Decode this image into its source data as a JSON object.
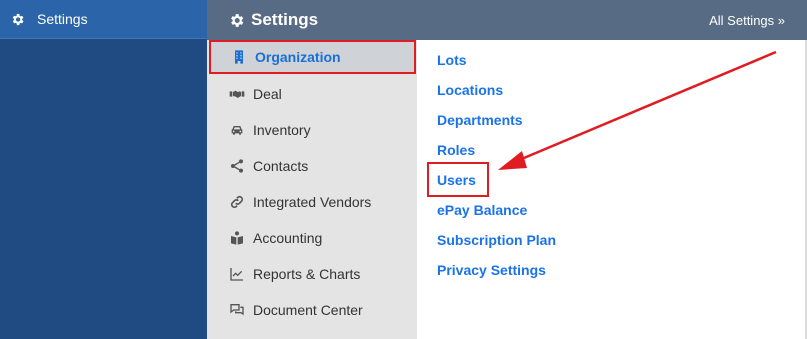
{
  "global_sidebar": {
    "settings_label": "Settings"
  },
  "header": {
    "title": "Settings",
    "all_settings": "All Settings »"
  },
  "categories": [
    {
      "label": "Organization",
      "icon": "building-icon",
      "active": true
    },
    {
      "label": "Deal",
      "icon": "handshake-icon",
      "active": false
    },
    {
      "label": "Inventory",
      "icon": "car-icon",
      "active": false
    },
    {
      "label": "Contacts",
      "icon": "share-icon",
      "active": false
    },
    {
      "label": "Integrated Vendors",
      "icon": "link-icon",
      "active": false
    },
    {
      "label": "Accounting",
      "icon": "book-reader-icon",
      "active": false
    },
    {
      "label": "Reports & Charts",
      "icon": "line-chart-icon",
      "active": false
    },
    {
      "label": "Document Center",
      "icon": "comments-icon",
      "active": false
    }
  ],
  "links": [
    {
      "label": "Lots"
    },
    {
      "label": "Locations"
    },
    {
      "label": "Departments"
    },
    {
      "label": "Roles"
    },
    {
      "label": "Users"
    },
    {
      "label": "ePay Balance"
    },
    {
      "label": "Subscription Plan"
    },
    {
      "label": "Privacy Settings"
    }
  ],
  "colors": {
    "accent": "#1a73e8",
    "highlight": "#e11b22",
    "header_bg": "#586b84",
    "sidebar_bg": "#1f4b82"
  }
}
